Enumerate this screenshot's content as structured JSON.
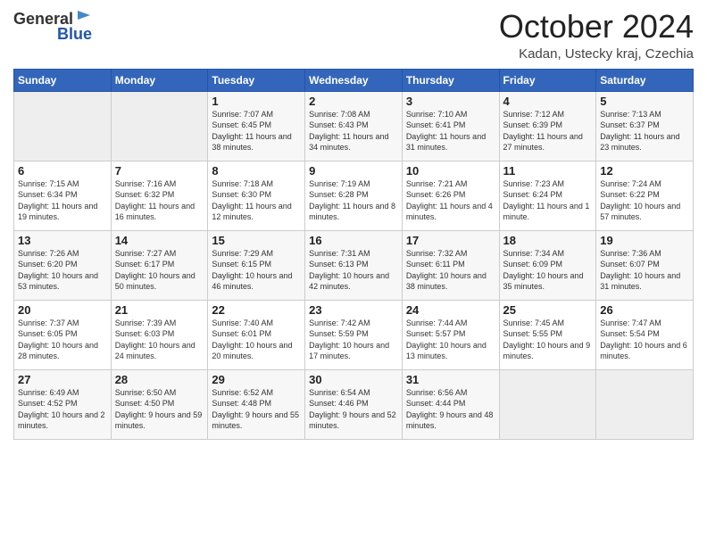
{
  "header": {
    "logo_line1": "General",
    "logo_line2": "Blue",
    "month_title": "October 2024",
    "subtitle": "Kadan, Ustecky kraj, Czechia"
  },
  "days_of_week": [
    "Sunday",
    "Monday",
    "Tuesday",
    "Wednesday",
    "Thursday",
    "Friday",
    "Saturday"
  ],
  "weeks": [
    [
      {
        "num": "",
        "empty": true
      },
      {
        "num": "",
        "empty": true
      },
      {
        "num": "1",
        "sunrise": "7:07 AM",
        "sunset": "6:45 PM",
        "daylight": "11 hours and 38 minutes."
      },
      {
        "num": "2",
        "sunrise": "7:08 AM",
        "sunset": "6:43 PM",
        "daylight": "11 hours and 34 minutes."
      },
      {
        "num": "3",
        "sunrise": "7:10 AM",
        "sunset": "6:41 PM",
        "daylight": "11 hours and 31 minutes."
      },
      {
        "num": "4",
        "sunrise": "7:12 AM",
        "sunset": "6:39 PM",
        "daylight": "11 hours and 27 minutes."
      },
      {
        "num": "5",
        "sunrise": "7:13 AM",
        "sunset": "6:37 PM",
        "daylight": "11 hours and 23 minutes."
      }
    ],
    [
      {
        "num": "6",
        "sunrise": "7:15 AM",
        "sunset": "6:34 PM",
        "daylight": "11 hours and 19 minutes."
      },
      {
        "num": "7",
        "sunrise": "7:16 AM",
        "sunset": "6:32 PM",
        "daylight": "11 hours and 16 minutes."
      },
      {
        "num": "8",
        "sunrise": "7:18 AM",
        "sunset": "6:30 PM",
        "daylight": "11 hours and 12 minutes."
      },
      {
        "num": "9",
        "sunrise": "7:19 AM",
        "sunset": "6:28 PM",
        "daylight": "11 hours and 8 minutes."
      },
      {
        "num": "10",
        "sunrise": "7:21 AM",
        "sunset": "6:26 PM",
        "daylight": "11 hours and 4 minutes."
      },
      {
        "num": "11",
        "sunrise": "7:23 AM",
        "sunset": "6:24 PM",
        "daylight": "11 hours and 1 minute."
      },
      {
        "num": "12",
        "sunrise": "7:24 AM",
        "sunset": "6:22 PM",
        "daylight": "10 hours and 57 minutes."
      }
    ],
    [
      {
        "num": "13",
        "sunrise": "7:26 AM",
        "sunset": "6:20 PM",
        "daylight": "10 hours and 53 minutes."
      },
      {
        "num": "14",
        "sunrise": "7:27 AM",
        "sunset": "6:17 PM",
        "daylight": "10 hours and 50 minutes."
      },
      {
        "num": "15",
        "sunrise": "7:29 AM",
        "sunset": "6:15 PM",
        "daylight": "10 hours and 46 minutes."
      },
      {
        "num": "16",
        "sunrise": "7:31 AM",
        "sunset": "6:13 PM",
        "daylight": "10 hours and 42 minutes."
      },
      {
        "num": "17",
        "sunrise": "7:32 AM",
        "sunset": "6:11 PM",
        "daylight": "10 hours and 38 minutes."
      },
      {
        "num": "18",
        "sunrise": "7:34 AM",
        "sunset": "6:09 PM",
        "daylight": "10 hours and 35 minutes."
      },
      {
        "num": "19",
        "sunrise": "7:36 AM",
        "sunset": "6:07 PM",
        "daylight": "10 hours and 31 minutes."
      }
    ],
    [
      {
        "num": "20",
        "sunrise": "7:37 AM",
        "sunset": "6:05 PM",
        "daylight": "10 hours and 28 minutes."
      },
      {
        "num": "21",
        "sunrise": "7:39 AM",
        "sunset": "6:03 PM",
        "daylight": "10 hours and 24 minutes."
      },
      {
        "num": "22",
        "sunrise": "7:40 AM",
        "sunset": "6:01 PM",
        "daylight": "10 hours and 20 minutes."
      },
      {
        "num": "23",
        "sunrise": "7:42 AM",
        "sunset": "5:59 PM",
        "daylight": "10 hours and 17 minutes."
      },
      {
        "num": "24",
        "sunrise": "7:44 AM",
        "sunset": "5:57 PM",
        "daylight": "10 hours and 13 minutes."
      },
      {
        "num": "25",
        "sunrise": "7:45 AM",
        "sunset": "5:55 PM",
        "daylight": "10 hours and 9 minutes."
      },
      {
        "num": "26",
        "sunrise": "7:47 AM",
        "sunset": "5:54 PM",
        "daylight": "10 hours and 6 minutes."
      }
    ],
    [
      {
        "num": "27",
        "sunrise": "6:49 AM",
        "sunset": "4:52 PM",
        "daylight": "10 hours and 2 minutes."
      },
      {
        "num": "28",
        "sunrise": "6:50 AM",
        "sunset": "4:50 PM",
        "daylight": "9 hours and 59 minutes."
      },
      {
        "num": "29",
        "sunrise": "6:52 AM",
        "sunset": "4:48 PM",
        "daylight": "9 hours and 55 minutes."
      },
      {
        "num": "30",
        "sunrise": "6:54 AM",
        "sunset": "4:46 PM",
        "daylight": "9 hours and 52 minutes."
      },
      {
        "num": "31",
        "sunrise": "6:56 AM",
        "sunset": "4:44 PM",
        "daylight": "9 hours and 48 minutes."
      },
      {
        "num": "",
        "empty": true
      },
      {
        "num": "",
        "empty": true
      }
    ]
  ]
}
